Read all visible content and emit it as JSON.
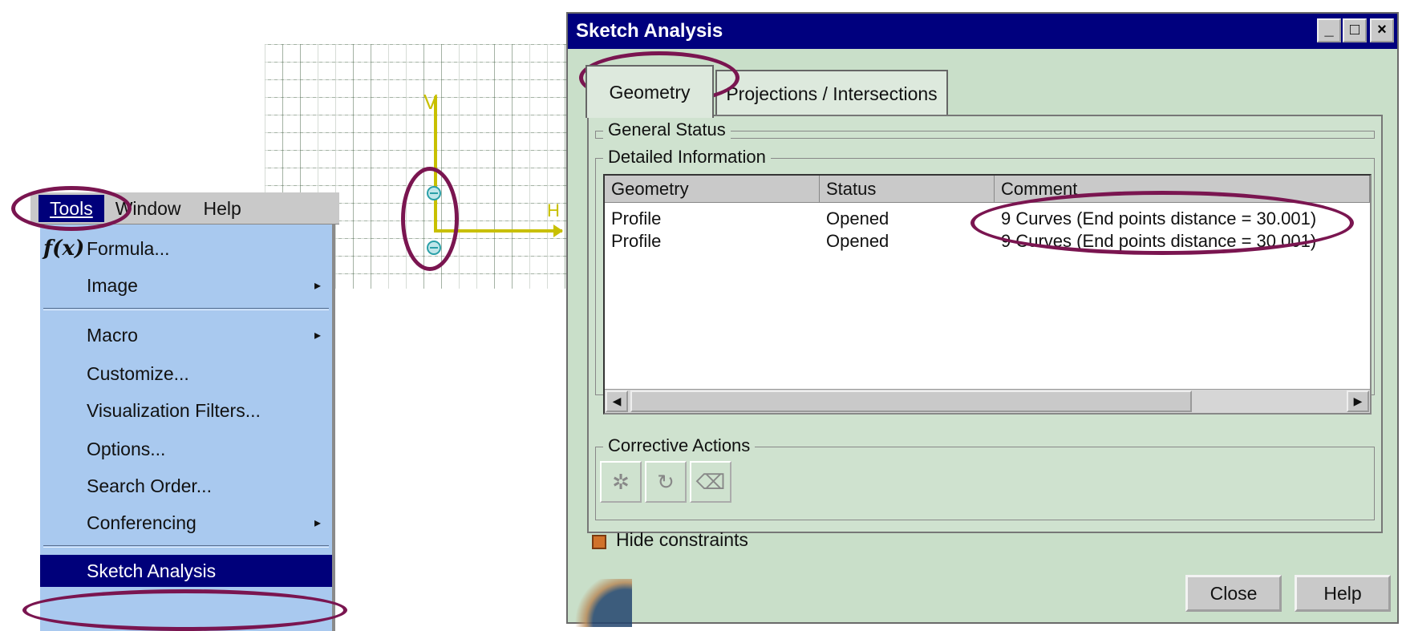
{
  "menubar": {
    "items": [
      {
        "label": "Tools",
        "active": true
      },
      {
        "label": "Window",
        "active": false
      },
      {
        "label": "Help",
        "active": false
      }
    ]
  },
  "menu": {
    "formula": "Formula...",
    "image": "Image",
    "macro": "Macro",
    "customize": "Customize...",
    "visualization_filters": "Visualization Filters...",
    "options": "Options...",
    "search_order": "Search Order...",
    "conferencing": "Conferencing",
    "sketch_analysis": "Sketch Analysis",
    "submenu_arrow": "▸",
    "fx_glyph": "f(x)"
  },
  "sketch": {
    "v_label": "V",
    "h_label": "H"
  },
  "dialog": {
    "title": "Sketch Analysis",
    "title_buttons": [
      "_",
      "□",
      "×"
    ],
    "tabs": [
      "Geometry",
      "Projections / Intersections"
    ],
    "general_status_label": "General Status",
    "detailed_info_label": "Detailed Information",
    "columns": [
      "Geometry",
      "Status",
      "Comment"
    ],
    "rows": [
      {
        "geometry": "Profile",
        "status": "Opened",
        "comment": "9 Curves (End points distance = 30.001)"
      },
      {
        "geometry": "Profile",
        "status": "Opened",
        "comment": "9 Curves (End points distance = 30.001)"
      }
    ],
    "corrective_actions_label": "Corrective Actions",
    "hide_constraints_label": "Hide constraints",
    "hide_constraints_checked": true,
    "close_label": "Close",
    "help_label": "Help"
  },
  "colors": {
    "annotation": "#7a1550",
    "title_bar": "#00007e",
    "menu_body": "#a9c9ef",
    "dialog_bg": "#c9dfc9"
  }
}
